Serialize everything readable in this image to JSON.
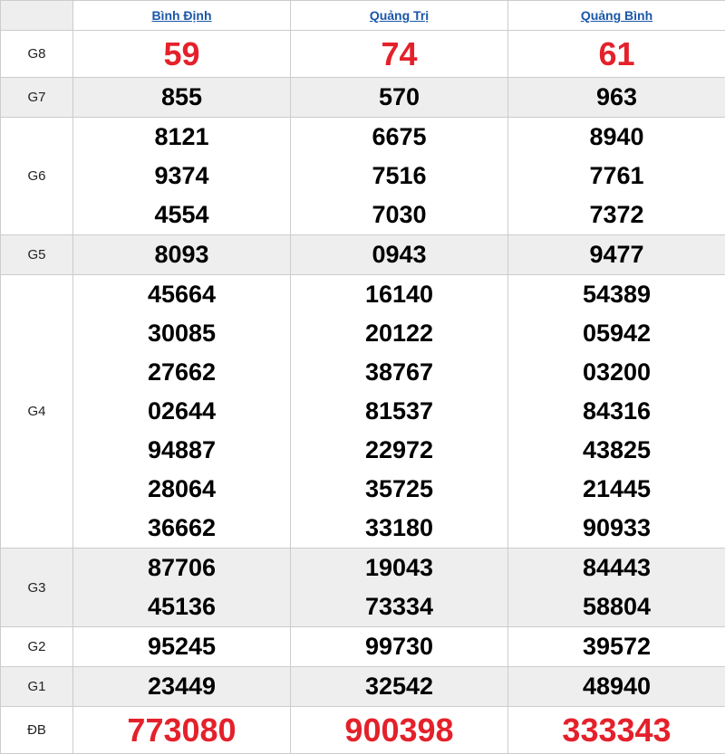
{
  "header": {
    "provinces": [
      "Bình Định",
      "Quảng Trị",
      "Quảng Bình"
    ]
  },
  "colors": {
    "accent_red": "#e4212b",
    "link_blue": "#1a57a8",
    "row_alt": "#eeeeee"
  },
  "prizes": [
    {
      "label": "G8",
      "values": [
        [
          "59"
        ],
        [
          "74"
        ],
        [
          "61"
        ]
      ]
    },
    {
      "label": "G7",
      "values": [
        [
          "855"
        ],
        [
          "570"
        ],
        [
          "963"
        ]
      ]
    },
    {
      "label": "G6",
      "values": [
        [
          "8121",
          "9374",
          "4554"
        ],
        [
          "6675",
          "7516",
          "7030"
        ],
        [
          "8940",
          "7761",
          "7372"
        ]
      ]
    },
    {
      "label": "G5",
      "values": [
        [
          "8093"
        ],
        [
          "0943"
        ],
        [
          "9477"
        ]
      ]
    },
    {
      "label": "G4",
      "values": [
        [
          "45664",
          "30085",
          "27662",
          "02644",
          "94887",
          "28064",
          "36662"
        ],
        [
          "16140",
          "20122",
          "38767",
          "81537",
          "22972",
          "35725",
          "33180"
        ],
        [
          "54389",
          "05942",
          "03200",
          "84316",
          "43825",
          "21445",
          "90933"
        ]
      ]
    },
    {
      "label": "G3",
      "values": [
        [
          "87706",
          "45136"
        ],
        [
          "19043",
          "73334"
        ],
        [
          "84443",
          "58804"
        ]
      ]
    },
    {
      "label": "G2",
      "values": [
        [
          "95245"
        ],
        [
          "99730"
        ],
        [
          "39572"
        ]
      ]
    },
    {
      "label": "G1",
      "values": [
        [
          "23449"
        ],
        [
          "32542"
        ],
        [
          "48940"
        ]
      ]
    },
    {
      "label": "ĐB",
      "values": [
        [
          "773080"
        ],
        [
          "900398"
        ],
        [
          "333343"
        ]
      ]
    }
  ]
}
